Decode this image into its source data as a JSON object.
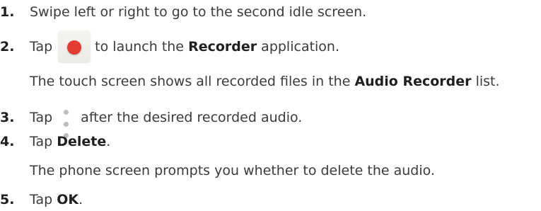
{
  "steps": [
    {
      "number": "1.",
      "text": "Swipe left or right to go to the second idle screen."
    },
    {
      "number": "2.",
      "before": "Tap",
      "icon": "recorder-app-icon",
      "after": "to launch the",
      "bold": "Recorder",
      "end": "application.",
      "note_before": "The touch screen shows all recorded files in the",
      "note_bold": "Audio Recorder",
      "note_after": "list."
    },
    {
      "number": "3.",
      "before": "Tap",
      "icon": "more-options-icon",
      "after": "after the desired recorded audio."
    },
    {
      "number": "4.",
      "before": "Tap",
      "bold": "Delete",
      "end": ".",
      "note": "The phone screen prompts you whether to delete the audio."
    },
    {
      "number": "5.",
      "before": "Tap",
      "bold": "OK",
      "end": "."
    }
  ],
  "colors": {
    "text": "#3b3b3b",
    "record_dot": "#e33b32",
    "icon_bg": "#f0efea",
    "more_dots": "#bdbdbd"
  }
}
